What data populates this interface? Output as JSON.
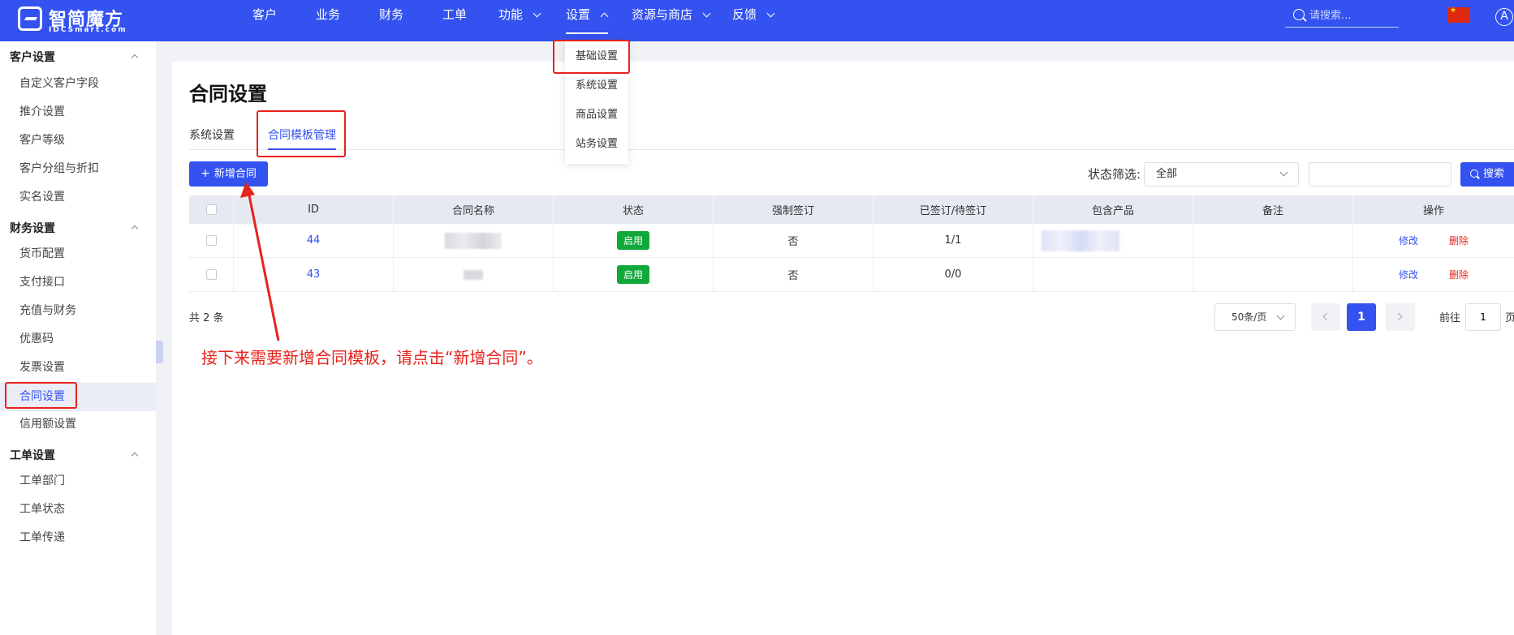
{
  "brand": {
    "title": "智简魔方",
    "subtitle": "IDCSmart.com"
  },
  "topnav": {
    "items": [
      "客户",
      "业务",
      "财务",
      "工单",
      "功能",
      "设置",
      "资源与商店",
      "反馈"
    ],
    "search_placeholder": "请搜索...",
    "avatar_letter": "A"
  },
  "settings_dropdown": [
    "基础设置",
    "系统设置",
    "商品设置",
    "站务设置"
  ],
  "sidebar": {
    "groups": [
      {
        "title": "客户设置",
        "items": [
          "自定义客户字段",
          "推介设置",
          "客户等级",
          "客户分组与折扣",
          "实名设置"
        ]
      },
      {
        "title": "财务设置",
        "items": [
          "货币配置",
          "支付接口",
          "充值与财务",
          "优惠码",
          "发票设置",
          "合同设置",
          "信用额设置"
        ]
      },
      {
        "title": "工单设置",
        "items": [
          "工单部门",
          "工单状态",
          "工单传递"
        ]
      }
    ],
    "active": "合同设置"
  },
  "page": {
    "title": "合同设置",
    "tabs": [
      "系统设置",
      "合同模板管理"
    ],
    "active_tab": "合同模板管理",
    "add_button": "新增合同",
    "filter_label": "状态筛选:",
    "filter_value": "全部",
    "search_button": "搜索"
  },
  "table": {
    "columns": [
      "ID",
      "合同名称",
      "状态",
      "强制签订",
      "已签订/待签订",
      "包含产品",
      "备注",
      "操作"
    ],
    "rows": [
      {
        "id": "44",
        "status": "启用",
        "forced": "否",
        "signed": "1/1",
        "edit": "修改",
        "delete": "删除"
      },
      {
        "id": "43",
        "status": "启用",
        "forced": "否",
        "signed": "0/0",
        "edit": "修改",
        "delete": "删除"
      }
    ]
  },
  "pagination": {
    "total": "共 2 条",
    "page_size": "50条/页",
    "current": "1",
    "goto_label": "前往",
    "goto_value": "1",
    "goto_suffix": "页"
  },
  "annotation": "接下来需要新增合同模板，请点击“新增合同”。",
  "colors": {
    "primary": "#3352f0",
    "highlight": "#e8221c",
    "success": "#11a83a"
  }
}
